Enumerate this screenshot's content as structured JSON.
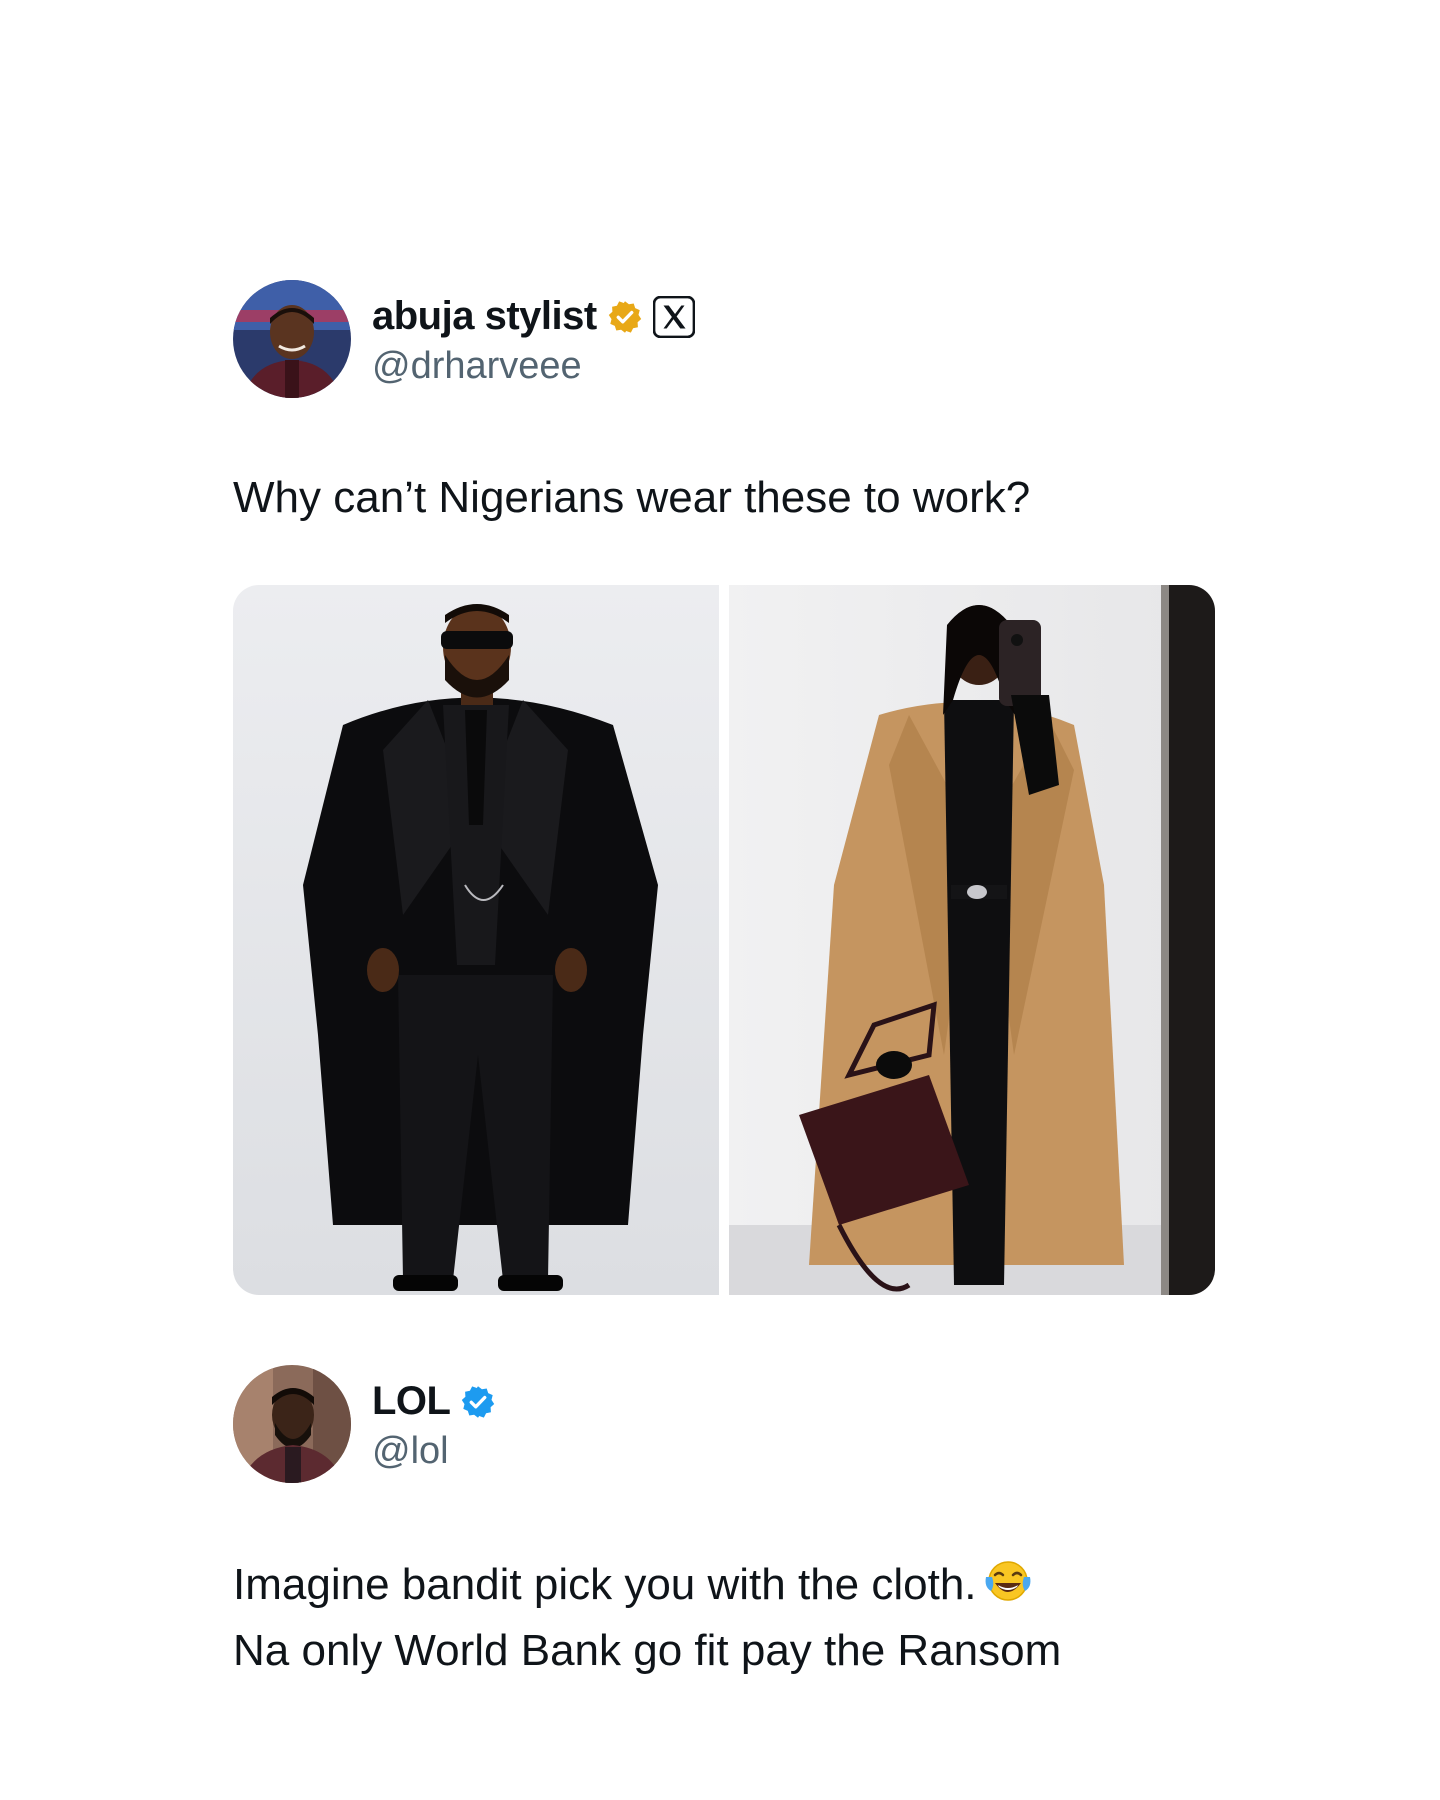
{
  "posts": [
    {
      "display_name": "abuja stylist",
      "handle": "@drharveee",
      "verified_badge_color": "#e8a817",
      "platform_icon": "x-logo-icon",
      "text_lines": [
        "Why can’t Nigerians wear these to work?"
      ],
      "media": [
        {
          "icon": "man-black-overcoat-photo"
        },
        {
          "icon": "woman-camel-coat-photo"
        }
      ]
    },
    {
      "display_name": "LOL",
      "handle": "@lol",
      "verified_badge_color": "#1d9bf0",
      "text_lines": [
        "Imagine bandit pick you with the cloth.",
        "Na only World Bank go fit pay the Ransom"
      ],
      "emoji": "face-with-tears-of-joy-icon"
    }
  ],
  "colors": {
    "text_primary": "#0f1419",
    "text_secondary": "#536471",
    "background": "#ffffff"
  }
}
